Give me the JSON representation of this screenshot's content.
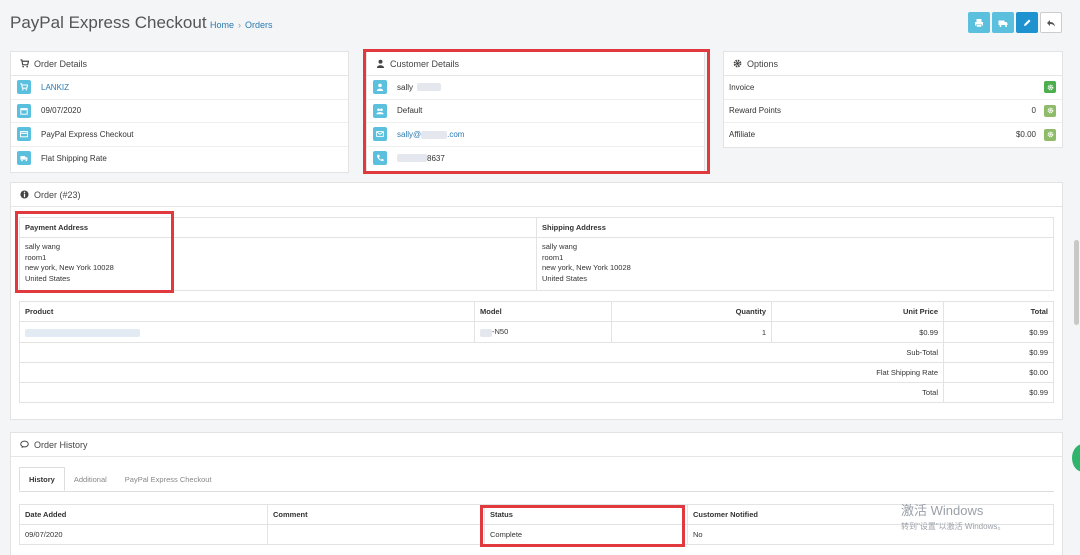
{
  "header": {
    "title": "PayPal Express Checkout",
    "breadcrumb": [
      "Home",
      "Orders"
    ],
    "breadcrumb_sep": "›",
    "buttons": [
      "print-icon",
      "truck-icon",
      "pencil-icon",
      "reply-icon"
    ]
  },
  "order_details": {
    "title": "Order Details",
    "rows": [
      {
        "icon": "cart-icon",
        "text": "LANKIZ"
      },
      {
        "icon": "calendar-icon",
        "text": "09/07/2020"
      },
      {
        "icon": "card-icon",
        "text": "PayPal Express Checkout"
      },
      {
        "icon": "truck-icon",
        "text": "Flat Shipping Rate"
      }
    ]
  },
  "customer_details": {
    "title": "Customer Details",
    "name": "sally",
    "group": "Default",
    "email_start": "sally@",
    "email_end": ".com",
    "phone_end": "8637"
  },
  "options": {
    "title": "Options",
    "rows": [
      {
        "label": "Invoice",
        "value": ""
      },
      {
        "label": "Reward Points",
        "value": "0"
      },
      {
        "label": "Affiliate",
        "value": "$0.00"
      }
    ]
  },
  "order": {
    "title": "Order (#23)",
    "payment_address": {
      "heading": "Payment Address",
      "lines": [
        "sally wang",
        "room1",
        "new york, New York 10028",
        "United States"
      ]
    },
    "shipping_address": {
      "heading": "Shipping Address",
      "lines": [
        "sally wang",
        "room1",
        "new york, New York 10028",
        "United States"
      ]
    },
    "columns": {
      "product": "Product",
      "model": "Model",
      "quantity": "Quantity",
      "unit_price": "Unit Price",
      "total": "Total"
    },
    "item": {
      "model_suffix": "-N50",
      "quantity": "1",
      "unit_price": "$0.99",
      "total": "$0.99"
    },
    "totals": [
      {
        "label": "Sub-Total",
        "value": "$0.99"
      },
      {
        "label": "Flat Shipping Rate",
        "value": "$0.00"
      },
      {
        "label": "Total",
        "value": "$0.99"
      }
    ]
  },
  "history": {
    "title": "Order History",
    "tabs": [
      "History",
      "Additional",
      "PayPal Express Checkout"
    ],
    "columns": {
      "date": "Date Added",
      "comment": "Comment",
      "status": "Status",
      "notified": "Customer Notified"
    },
    "row": {
      "date": "09/07/2020",
      "comment": "",
      "status": "Complete",
      "notified": "No"
    }
  },
  "watermark": {
    "line1": "激活 Windows",
    "line2": "转到\"设置\"以激活 Windows。"
  },
  "colors": {
    "accent": "#1e91cf",
    "info": "#5bc0de",
    "success": "#4cae4c",
    "highlight": "#e03a3e"
  }
}
